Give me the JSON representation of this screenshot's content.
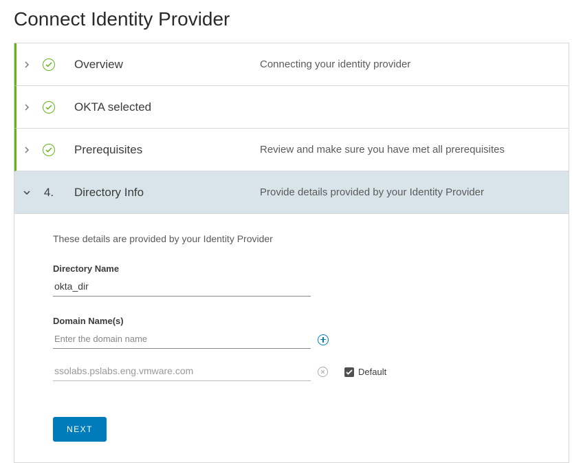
{
  "page_title": "Connect Identity Provider",
  "steps": [
    {
      "title": "Overview",
      "desc": "Connecting your identity provider",
      "status": "completed"
    },
    {
      "title": "OKTA selected",
      "desc": "",
      "status": "completed"
    },
    {
      "title": "Prerequisites",
      "desc": "Review and make sure you have met all prerequisites",
      "status": "completed"
    },
    {
      "number": "4.",
      "title": "Directory Info",
      "desc": "Provide details provided by your Identity Provider",
      "status": "current"
    }
  ],
  "body": {
    "intro": "These details are provided by your Identity Provider",
    "directory_name_label": "Directory Name",
    "directory_name_value": "okta_dir",
    "domain_names_label": "Domain Name(s)",
    "domain_input_placeholder": "Enter the domain name",
    "domain_input_value": "",
    "existing_domain": "ssolabs.pslabs.eng.vmware.com",
    "default_label": "Default",
    "default_checked": true,
    "next_button": "NEXT"
  }
}
